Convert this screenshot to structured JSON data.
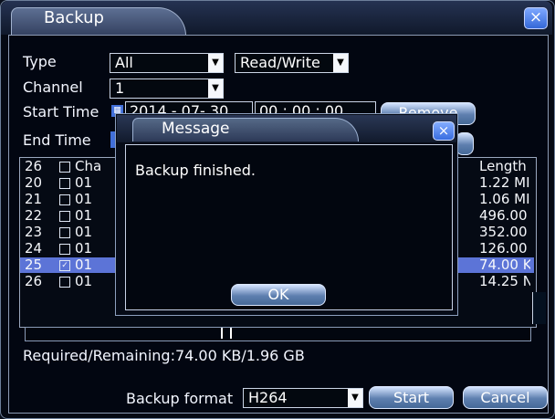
{
  "window": {
    "title": "Backup",
    "close_icon": "×"
  },
  "filters": {
    "type_label": "Type",
    "type_value": "All",
    "type_mode": "Read/Write",
    "channel_label": "Channel",
    "channel_value": "1",
    "start_time_label": "Start Time",
    "start_date": "2014 - 07- 30",
    "start_time": "00 : 00 : 00",
    "end_time_label": "End Time"
  },
  "buttons": {
    "remove": "Remove",
    "start": "Start",
    "cancel": "Cancel",
    "ok": "OK"
  },
  "table": {
    "header_count": "26",
    "header_channel": "Cha",
    "header_length": "Length",
    "rows": [
      {
        "idx": "20",
        "checked": false,
        "channel": "01",
        "length": "1.22 MI"
      },
      {
        "idx": "21",
        "checked": false,
        "channel": "01",
        "length": "1.06 MI"
      },
      {
        "idx": "22",
        "checked": false,
        "channel": "01",
        "length": "496.00"
      },
      {
        "idx": "23",
        "checked": false,
        "channel": "01",
        "length": "352.00"
      },
      {
        "idx": "24",
        "checked": false,
        "channel": "01",
        "length": "126.00"
      },
      {
        "idx": "25",
        "checked": true,
        "channel": "01",
        "length": "74.00 K",
        "selected": true
      },
      {
        "idx": "26",
        "checked": false,
        "channel": "01",
        "length": "14.25 N"
      }
    ]
  },
  "status": {
    "required_remaining": "Required/Remaining:74.00 KB/1.96 GB"
  },
  "backup": {
    "format_label": "Backup format",
    "format_value": "H264"
  },
  "dialog": {
    "title": "Message",
    "message": "Backup finished.",
    "close_icon": "×"
  },
  "colors": {
    "accent": "#5c74d7",
    "button_blue": "#4f73a8"
  }
}
